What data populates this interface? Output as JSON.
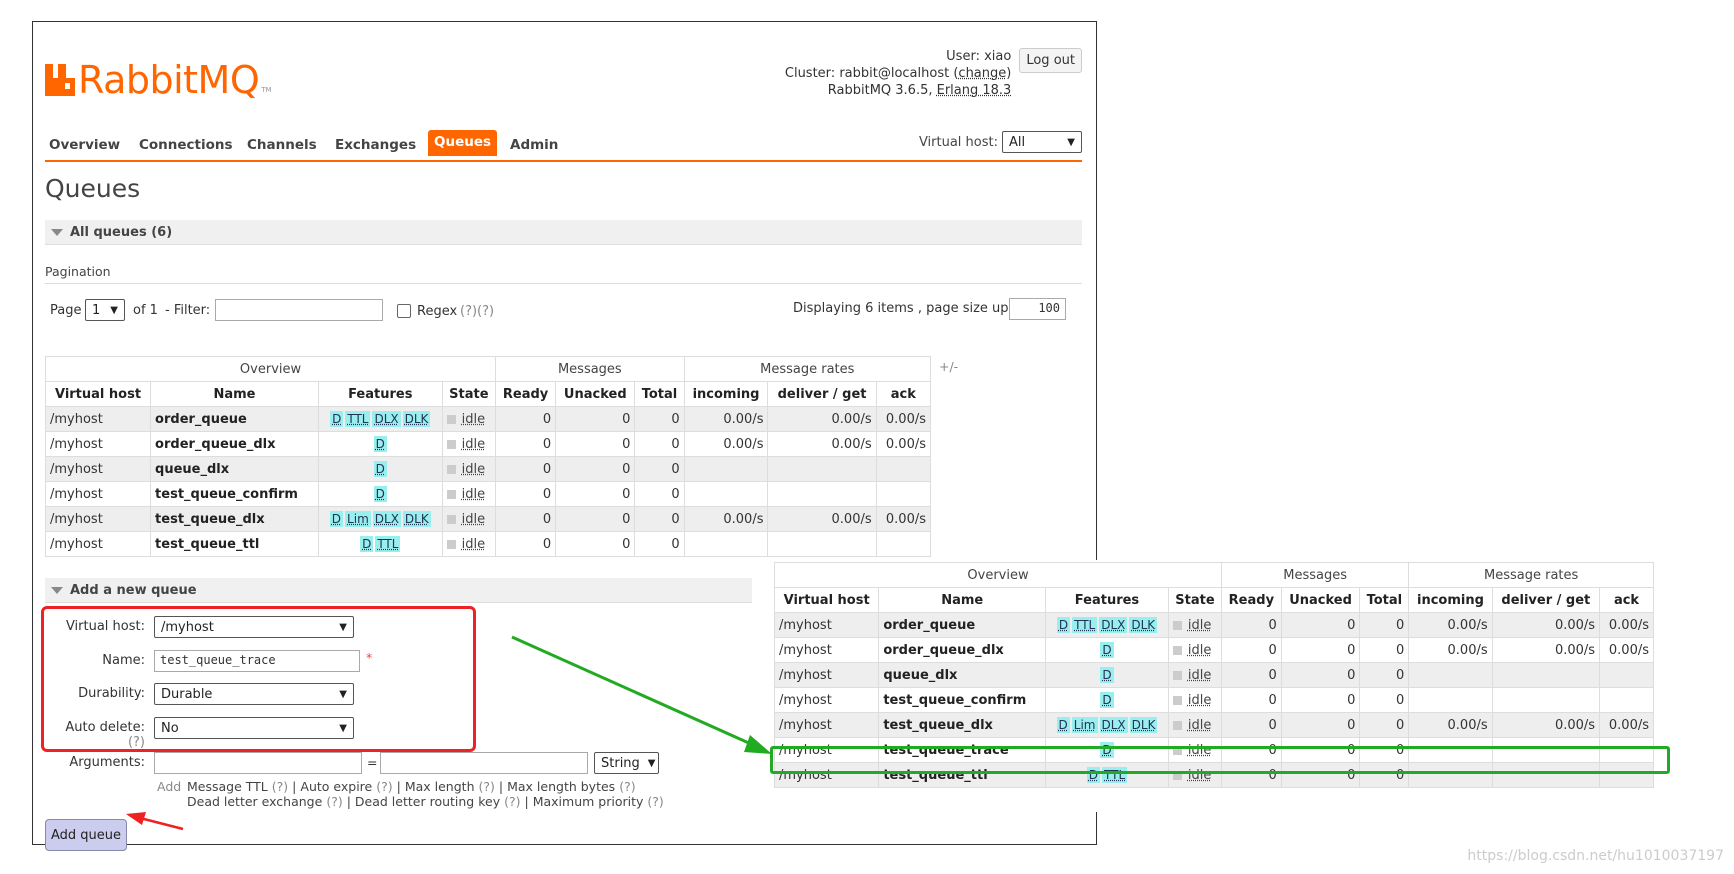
{
  "app": {
    "logo_text_a": "RabbitMQ",
    "tm": "TM"
  },
  "header": {
    "user_label": "User:",
    "user": "xiao",
    "cluster_label": "Cluster:",
    "cluster": "rabbit@localhost",
    "change": "change",
    "version": "RabbitMQ 3.6.5,",
    "erlang": "Erlang 18.3",
    "logout": "Log out"
  },
  "nav": {
    "tabs": [
      "Overview",
      "Connections",
      "Channels",
      "Exchanges",
      "Queues",
      "Admin"
    ],
    "active": "Queues",
    "vhost_label": "Virtual host:",
    "vhost_value": "All"
  },
  "page": {
    "title": "Queues",
    "all_queues": "All queues (6)"
  },
  "pagination": {
    "label": "Pagination",
    "page_label": "Page",
    "page_value": "1",
    "of": "of 1",
    "filter_label": "- Filter:",
    "filter_value": "",
    "regex": "Regex",
    "regex_hint": "(?)(?)",
    "displaying": "Displaying 6 items , page size up to:",
    "page_size": "100"
  },
  "table": {
    "groups": [
      "Overview",
      "Messages",
      "Message rates"
    ],
    "plusminus": "+/-",
    "columns": [
      "Virtual host",
      "Name",
      "Features",
      "State",
      "Ready",
      "Unacked",
      "Total",
      "incoming",
      "deliver / get",
      "ack"
    ],
    "rows": [
      {
        "vhost": "/myhost",
        "name": "order_queue",
        "features": [
          "D",
          "TTL",
          "DLX",
          "DLK"
        ],
        "state": "idle",
        "ready": "0",
        "unacked": "0",
        "total": "0",
        "incoming": "0.00/s",
        "deliver": "0.00/s",
        "ack": "0.00/s"
      },
      {
        "vhost": "/myhost",
        "name": "order_queue_dlx",
        "features": [
          "D"
        ],
        "state": "idle",
        "ready": "0",
        "unacked": "0",
        "total": "0",
        "incoming": "0.00/s",
        "deliver": "0.00/s",
        "ack": "0.00/s"
      },
      {
        "vhost": "/myhost",
        "name": "queue_dlx",
        "features": [
          "D"
        ],
        "state": "idle",
        "ready": "0",
        "unacked": "0",
        "total": "0",
        "incoming": "",
        "deliver": "",
        "ack": ""
      },
      {
        "vhost": "/myhost",
        "name": "test_queue_confirm",
        "features": [
          "D"
        ],
        "state": "idle",
        "ready": "0",
        "unacked": "0",
        "total": "0",
        "incoming": "",
        "deliver": "",
        "ack": ""
      },
      {
        "vhost": "/myhost",
        "name": "test_queue_dlx",
        "features": [
          "D",
          "Lim",
          "DLX",
          "DLK"
        ],
        "state": "idle",
        "ready": "0",
        "unacked": "0",
        "total": "0",
        "incoming": "0.00/s",
        "deliver": "0.00/s",
        "ack": "0.00/s"
      },
      {
        "vhost": "/myhost",
        "name": "test_queue_ttl",
        "features": [
          "D",
          "TTL"
        ],
        "state": "idle",
        "ready": "0",
        "unacked": "0",
        "total": "0",
        "incoming": "",
        "deliver": "",
        "ack": ""
      }
    ]
  },
  "add_queue": {
    "section": "Add a new queue",
    "vhost_label": "Virtual host:",
    "vhost_value": "/myhost",
    "name_label": "Name:",
    "name_value": "test_queue_trace",
    "required": "*",
    "durability_label": "Durability:",
    "durability_value": "Durable",
    "autodelete_label": "Auto delete:",
    "autodelete_hint": "(?)",
    "autodelete_value": "No",
    "arguments_label": "Arguments:",
    "eq": "=",
    "type_value": "String",
    "add": "Add",
    "hints_line1": [
      "Message TTL",
      "Auto expire",
      "Max length",
      "Max length bytes"
    ],
    "hints_line2": [
      "Dead letter exchange",
      "Dead letter routing key",
      "Maximum priority"
    ],
    "hint_q": "(?)",
    "sep": "|",
    "button": "Add queue"
  },
  "zoom_table": {
    "groups": [
      "Overview",
      "Messages",
      "Message rates"
    ],
    "columns": [
      "Virtual host",
      "Name",
      "Features",
      "State",
      "Ready",
      "Unacked",
      "Total",
      "incoming",
      "deliver / get",
      "ack"
    ],
    "rows": [
      {
        "vhost": "/myhost",
        "name": "order_queue",
        "features": [
          "D",
          "TTL",
          "DLX",
          "DLK"
        ],
        "state": "idle",
        "ready": "0",
        "unacked": "0",
        "total": "0",
        "incoming": "0.00/s",
        "deliver": "0.00/s",
        "ack": "0.00/s"
      },
      {
        "vhost": "/myhost",
        "name": "order_queue_dlx",
        "features": [
          "D"
        ],
        "state": "idle",
        "ready": "0",
        "unacked": "0",
        "total": "0",
        "incoming": "0.00/s",
        "deliver": "0.00/s",
        "ack": "0.00/s"
      },
      {
        "vhost": "/myhost",
        "name": "queue_dlx",
        "features": [
          "D"
        ],
        "state": "idle",
        "ready": "0",
        "unacked": "0",
        "total": "0",
        "incoming": "",
        "deliver": "",
        "ack": ""
      },
      {
        "vhost": "/myhost",
        "name": "test_queue_confirm",
        "features": [
          "D"
        ],
        "state": "idle",
        "ready": "0",
        "unacked": "0",
        "total": "0",
        "incoming": "",
        "deliver": "",
        "ack": ""
      },
      {
        "vhost": "/myhost",
        "name": "test_queue_dlx",
        "features": [
          "D",
          "Lim",
          "DLX",
          "DLK"
        ],
        "state": "idle",
        "ready": "0",
        "unacked": "0",
        "total": "0",
        "incoming": "0.00/s",
        "deliver": "0.00/s",
        "ack": "0.00/s"
      },
      {
        "vhost": "/myhost",
        "name": "test_queue_trace",
        "features": [
          "D"
        ],
        "state": "idle",
        "ready": "0",
        "unacked": "0",
        "total": "0",
        "incoming": "",
        "deliver": "",
        "ack": ""
      },
      {
        "vhost": "/myhost",
        "name": "test_queue_ttl",
        "features": [
          "D",
          "TTL"
        ],
        "state": "idle",
        "ready": "0",
        "unacked": "0",
        "total": "0",
        "incoming": "",
        "deliver": "",
        "ack": ""
      }
    ]
  },
  "annotations": {
    "red": "#e22",
    "green": "#2a2"
  },
  "watermark": "https://blog.csdn.net/hu1010037197",
  "colors": {
    "accent": "#ff6600",
    "tag": "#99eeee",
    "button": "#ccccee"
  }
}
